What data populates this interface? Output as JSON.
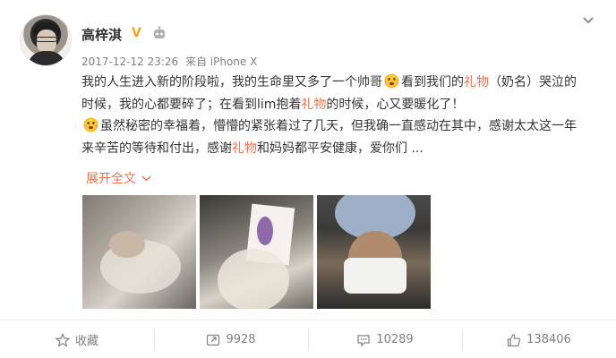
{
  "post": {
    "author": "高梓淇",
    "time": "2017-12-12 23:26",
    "source": "来自 iPhone X",
    "text_parts": [
      "我的人生进入新的阶段啦，我的生命里又多了一个帅哥",
      "看到我们的",
      "礼物",
      "（奶名）哭泣的时候，我的心都要碎了；在看到lim抱着",
      "礼物",
      "的时候，心又要暖化了！",
      "虽然秘密的幸福着，懵懵的紧张着过了几天，但我确一直感动在其中，感谢太太这一年来辛苦的等待和付出，感谢",
      "礼物",
      "和妈妈都平安健康，爱你们 ..."
    ],
    "expand_label": "展开全文",
    "colors": {
      "link": "#eb7350",
      "badge": "#f5a623",
      "text": "#333333",
      "muted": "#808080"
    },
    "icons": {
      "verified": "verified-v-badge-icon",
      "member": "member-robot-icon",
      "menu": "chevron-down-icon",
      "emoji": "emoji-face-icon"
    }
  },
  "actions": {
    "favorite_label": "收藏",
    "repost_count": "9928",
    "comment_count": "10289",
    "like_count": "138406"
  }
}
